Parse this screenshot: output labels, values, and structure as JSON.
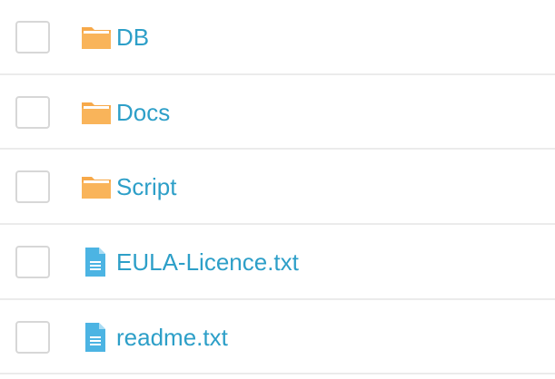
{
  "file_list": {
    "items": [
      {
        "name": "DB",
        "type": "folder",
        "icon": "folder-icon",
        "checked": false
      },
      {
        "name": "Docs",
        "type": "folder",
        "icon": "folder-icon",
        "checked": false
      },
      {
        "name": "Script",
        "type": "folder",
        "icon": "folder-icon",
        "checked": false
      },
      {
        "name": "EULA-Licence.txt",
        "type": "file",
        "icon": "text-file-icon",
        "checked": false
      },
      {
        "name": "readme.txt",
        "type": "file",
        "icon": "text-file-icon",
        "checked": false
      }
    ]
  },
  "colors": {
    "link": "#2d9fc8",
    "folder": "#f7a94a",
    "file": "#4cb4e3",
    "divider": "#ebebeb",
    "checkbox_border": "#d7d7d7"
  }
}
